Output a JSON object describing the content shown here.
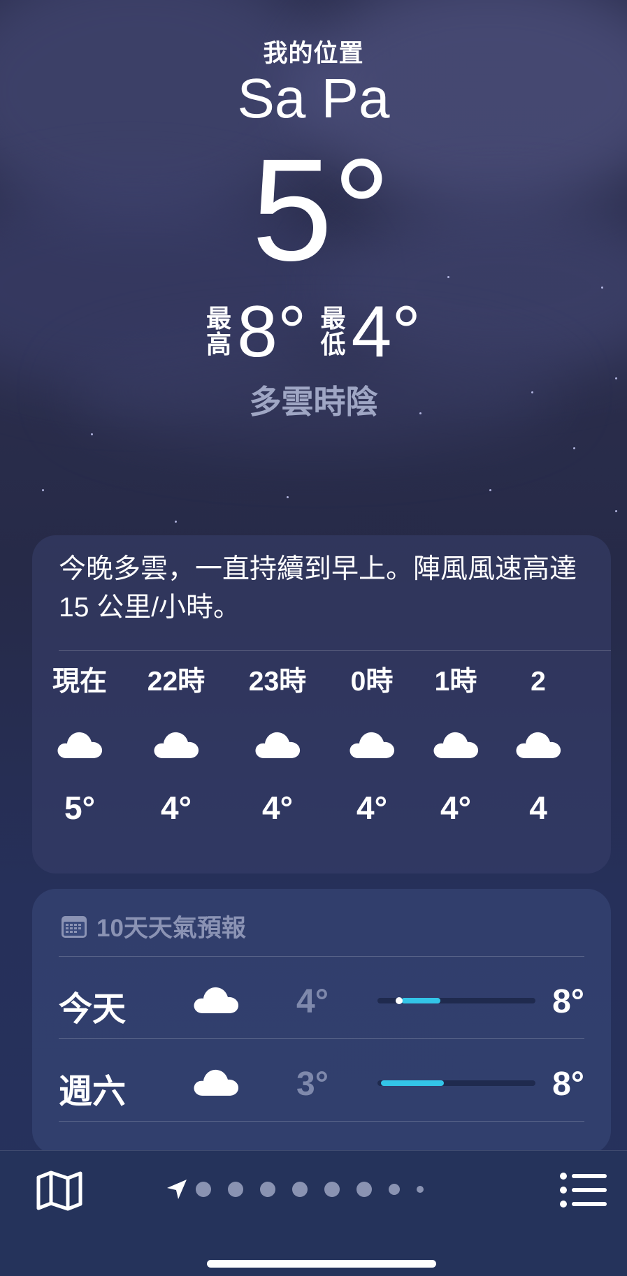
{
  "location": {
    "label": "我的位置",
    "city": "Sa Pa",
    "temperature": "5°",
    "high_label": "最高",
    "high": "8°",
    "low_label": "最低",
    "low": "4°",
    "condition": "多雲時陰"
  },
  "summary": {
    "text": "今晚多雲，一直持續到早上。陣風風速高達 15 公里/小時。"
  },
  "hourly": [
    {
      "time": "現在",
      "icon": "cloud-icon",
      "temp": "5°"
    },
    {
      "time": "22時",
      "icon": "cloud-icon",
      "temp": "4°"
    },
    {
      "time": "23時",
      "icon": "cloud-icon",
      "temp": "4°"
    },
    {
      "time": "0時",
      "icon": "cloud-icon",
      "temp": "4°"
    },
    {
      "time": "1時",
      "icon": "cloud-icon",
      "temp": "4°"
    },
    {
      "time": "2",
      "icon": "cloud-icon",
      "temp": "4"
    }
  ],
  "forecast": {
    "title": "10天天氣預報",
    "icon": "calendar-icon",
    "days": [
      {
        "day": "今天",
        "icon": "cloud-icon",
        "low": "4°",
        "high": "8°",
        "range_start": 0.15,
        "range_end": 0.4,
        "current": 0.15
      },
      {
        "day": "週六",
        "icon": "cloud-icon",
        "low": "3°",
        "high": "8°",
        "range_start": 0.02,
        "range_end": 0.42
      }
    ]
  },
  "toolbar": {
    "map_icon": "map-icon",
    "location_icon": "location-arrow-icon",
    "list_icon": "list-icon",
    "page_count": 9
  },
  "colors": {
    "accent_bar": "#33c5e8",
    "condition_text": "#9fa6c4",
    "muted": "#8b93b4"
  }
}
